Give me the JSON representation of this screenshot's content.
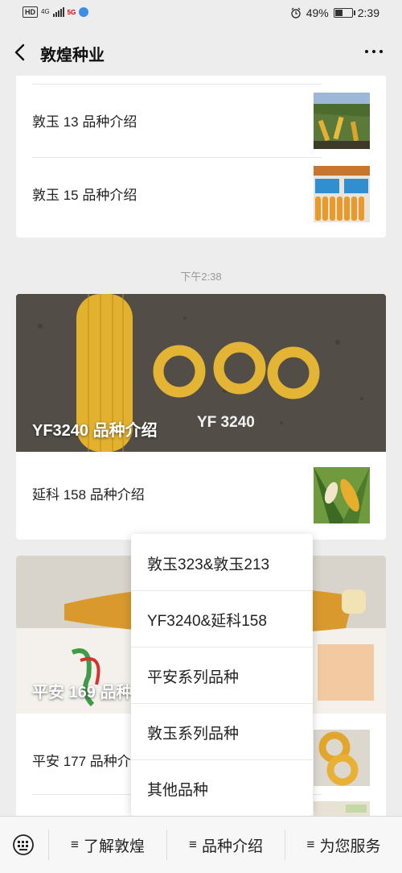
{
  "status_bar": {
    "left_tags": [
      "HD",
      "4G",
      "5G"
    ],
    "battery": "49%",
    "battery_level": 0.49,
    "time": "2:39"
  },
  "nav": {
    "back_icon": "chevron-left-icon",
    "title": "敦煌种业",
    "more_icon": "more-dots-icon"
  },
  "article_group_1": {
    "items": [
      {
        "label": "敦玉 13 品种介绍"
      },
      {
        "label": "敦玉 15 品种介绍"
      }
    ]
  },
  "timestamp": "下午2:38",
  "article_group_2": {
    "hero": {
      "title": "YF3240 品种介绍",
      "image_text": "YF 3240"
    },
    "items": [
      {
        "label": "延科 158 品种介绍"
      }
    ]
  },
  "article_group_3": {
    "hero": {
      "title": "平安 169 品种介绍"
    },
    "items": [
      {
        "label": "平安 177 品种介绍"
      }
    ]
  },
  "popup_menu": {
    "items": [
      {
        "label": "敦玉323&敦玉213"
      },
      {
        "label": "YF3240&延科158"
      },
      {
        "label": "平安系列品种"
      },
      {
        "label": "敦玉系列品种"
      },
      {
        "label": "其他品种"
      }
    ]
  },
  "bottom_menu": {
    "keyboard_icon": "keyboard-icon",
    "items": [
      {
        "label": "了解敦煌"
      },
      {
        "label": "品种介绍"
      },
      {
        "label": "为您服务"
      }
    ]
  },
  "colors": {
    "background": "#ededed",
    "card": "#ffffff",
    "corn": "#e8b530"
  }
}
